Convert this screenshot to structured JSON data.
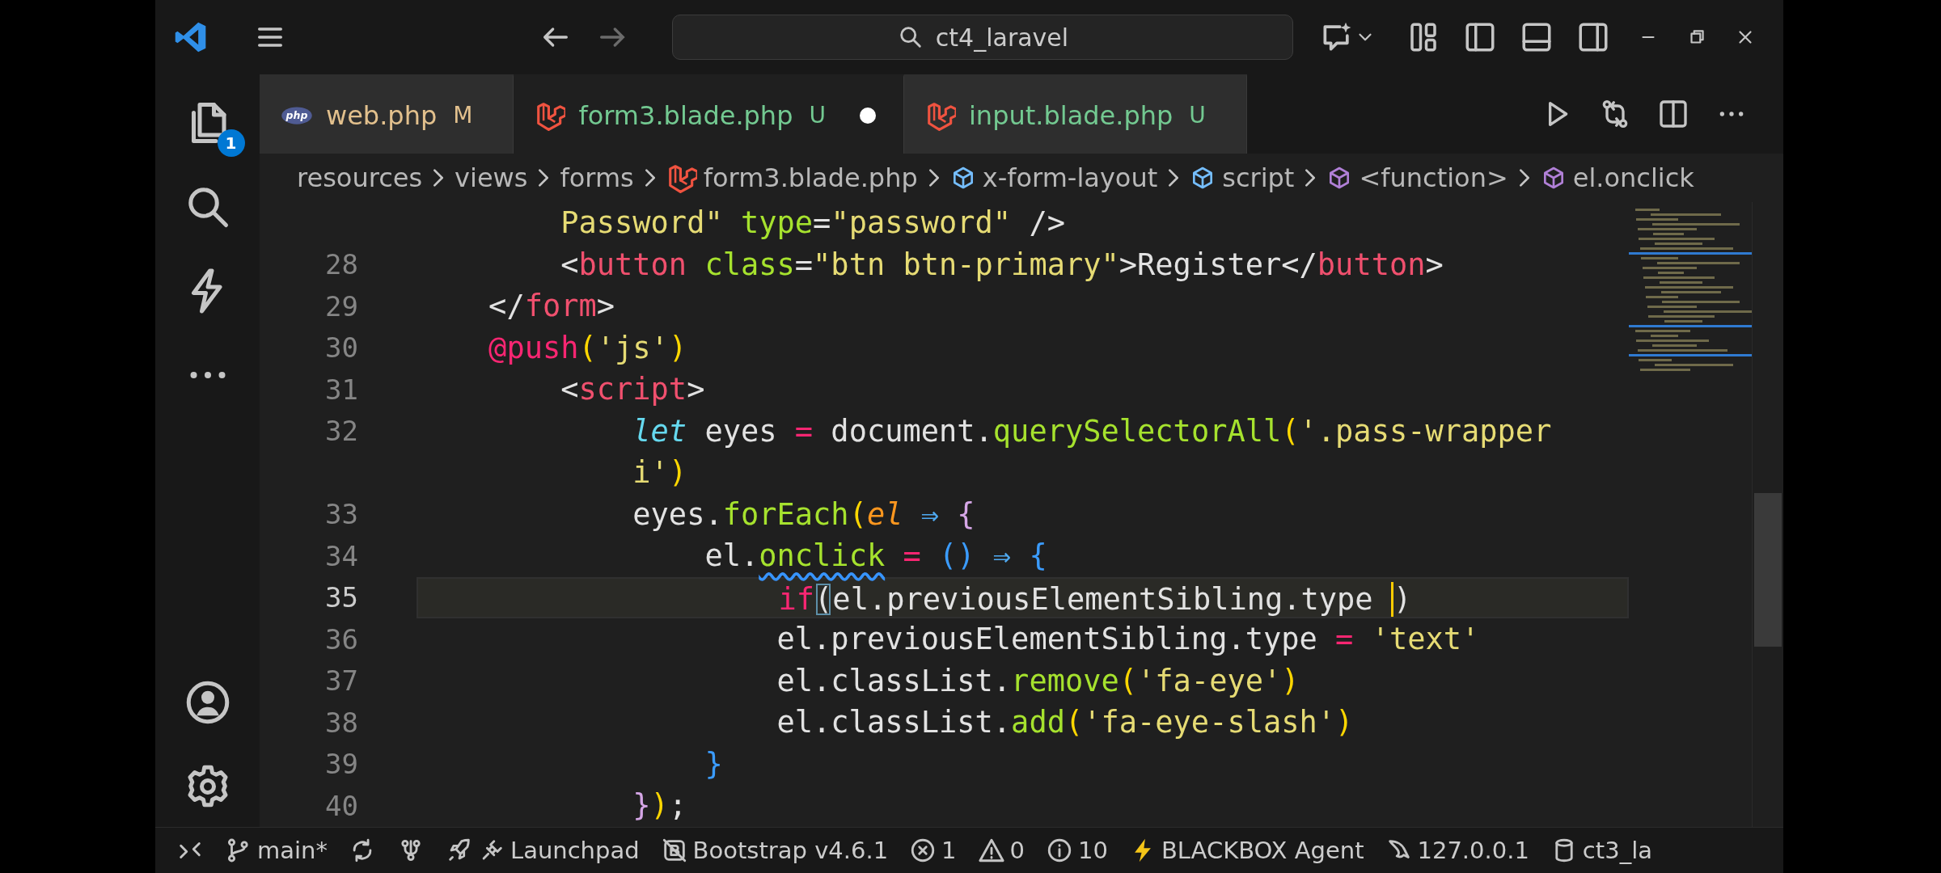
{
  "title_bar": {
    "search": "ct4_laravel"
  },
  "activity_bar": {
    "explorer_badge": "1"
  },
  "tabs": [
    {
      "label": "web.php",
      "kind": "php",
      "color": "#e2c08d",
      "status": "M",
      "selected": false,
      "dirty": false
    },
    {
      "label": "form3.blade.php",
      "kind": "blade",
      "color": "#73c991",
      "status": "U",
      "selected": true,
      "dirty": true
    },
    {
      "label": "input.blade.php",
      "kind": "blade",
      "color": "#73c991",
      "status": "U",
      "selected": false,
      "dirty": false
    }
  ],
  "breadcrumbs": [
    {
      "label": "resources",
      "kind": "folder"
    },
    {
      "label": "views",
      "kind": "folder"
    },
    {
      "label": "forms",
      "kind": "folder"
    },
    {
      "label": "form3.blade.php",
      "kind": "blade"
    },
    {
      "label": "x-form-layout",
      "kind": "element"
    },
    {
      "label": "script",
      "kind": "element"
    },
    {
      "label": "<function>",
      "kind": "method"
    },
    {
      "label": "el.onclick",
      "kind": "method"
    }
  ],
  "editor": {
    "lines": [
      {
        "current": false,
        "tokens": [
          {
            "text": "        Password\"",
            "kind": "string"
          },
          {
            "text": " type",
            "kind": "attr"
          },
          {
            "text": "=",
            "kind": "plain"
          },
          {
            "text": "\"password\"",
            "kind": "string"
          },
          {
            "text": " />",
            "kind": "plain"
          }
        ]
      },
      {
        "number": "28",
        "current": false,
        "tokens": [
          {
            "text": "        <",
            "kind": "plain"
          },
          {
            "text": "button",
            "kind": "tag"
          },
          {
            "text": " class",
            "kind": "attr"
          },
          {
            "text": "=",
            "kind": "plain"
          },
          {
            "text": "\"btn btn-primary\"",
            "kind": "string"
          },
          {
            "text": ">Register</",
            "kind": "plain"
          },
          {
            "text": "button",
            "kind": "tag"
          },
          {
            "text": ">",
            "kind": "plain"
          }
        ]
      },
      {
        "number": "29",
        "current": false,
        "tokens": [
          {
            "text": "    </",
            "kind": "plain"
          },
          {
            "text": "form",
            "kind": "tag"
          },
          {
            "text": ">",
            "kind": "plain"
          }
        ]
      },
      {
        "number": "30",
        "current": false,
        "tokens": [
          {
            "text": "    @push",
            "kind": "directive"
          },
          {
            "text": "(",
            "kind": "bracket1"
          },
          {
            "text": "'js'",
            "kind": "string"
          },
          {
            "text": ")",
            "kind": "bracket1"
          }
        ]
      },
      {
        "number": "31",
        "current": false,
        "tokens": [
          {
            "text": "        <",
            "kind": "plain"
          },
          {
            "text": "script",
            "kind": "tag"
          },
          {
            "text": ">",
            "kind": "plain"
          }
        ]
      },
      {
        "number": "32",
        "current": false,
        "tokens": [
          {
            "text": "            let",
            "kind": "keyword"
          },
          {
            "text": " eyes ",
            "kind": "plain"
          },
          {
            "text": "=",
            "kind": "op"
          },
          {
            "text": " document.",
            "kind": "plain"
          },
          {
            "text": "querySelectorAll",
            "kind": "func"
          },
          {
            "text": "(",
            "kind": "bracket1"
          },
          {
            "text": "'.pass-wrapper",
            "kind": "string"
          }
        ]
      },
      {
        "current": false,
        "tokens": [
          {
            "text": "            i'",
            "kind": "string"
          },
          {
            "text": ")",
            "kind": "bracket1"
          }
        ]
      },
      {
        "number": "33",
        "current": false,
        "tokens": [
          {
            "text": "            eyes.",
            "kind": "plain"
          },
          {
            "text": "forEach",
            "kind": "func"
          },
          {
            "text": "(",
            "kind": "bracket1"
          },
          {
            "text": "el",
            "kind": "param"
          },
          {
            "text": " ⇒ ",
            "kind": "arrow"
          },
          {
            "text": "{",
            "kind": "bracket2"
          }
        ]
      },
      {
        "number": "34",
        "current": false,
        "tokens": [
          {
            "text": "                el.",
            "kind": "plain"
          },
          {
            "text": "onclick",
            "kind": "func-warn"
          },
          {
            "text": " = ",
            "kind": "op"
          },
          {
            "text": "()",
            "kind": "bracket3"
          },
          {
            "text": " ⇒ ",
            "kind": "arrow"
          },
          {
            "text": "{",
            "kind": "bracket3"
          }
        ]
      },
      {
        "number": "35",
        "current": true,
        "tokens": [
          {
            "text": "                    if",
            "kind": "control"
          },
          {
            "text": "(",
            "kind": "match"
          },
          {
            "text": "el.previousElementSibling.type ",
            "kind": "plain"
          },
          {
            "text": ")",
            "kind": "caret"
          }
        ]
      },
      {
        "number": "36",
        "current": false,
        "tokens": [
          {
            "text": "                    el.previousElementSibling.type ",
            "kind": "plain"
          },
          {
            "text": "= ",
            "kind": "op"
          },
          {
            "text": "'text'",
            "kind": "string"
          }
        ]
      },
      {
        "number": "37",
        "current": false,
        "tokens": [
          {
            "text": "                    el.classList.",
            "kind": "plain"
          },
          {
            "text": "remove",
            "kind": "func"
          },
          {
            "text": "(",
            "kind": "bracket1"
          },
          {
            "text": "'fa-eye'",
            "kind": "string"
          },
          {
            "text": ")",
            "kind": "bracket1"
          }
        ]
      },
      {
        "number": "38",
        "current": false,
        "tokens": [
          {
            "text": "                    el.classList.",
            "kind": "plain"
          },
          {
            "text": "add",
            "kind": "func"
          },
          {
            "text": "(",
            "kind": "bracket1"
          },
          {
            "text": "'fa-eye-slash'",
            "kind": "string"
          },
          {
            "text": ")",
            "kind": "bracket1"
          }
        ]
      },
      {
        "number": "39",
        "current": false,
        "tokens": [
          {
            "text": "                }",
            "kind": "bracket3"
          }
        ]
      },
      {
        "number": "40",
        "current": false,
        "tokens": [
          {
            "text": "            }",
            "kind": "bracket2"
          },
          {
            "text": ")",
            "kind": "bracket1"
          },
          {
            "text": ";",
            "kind": "plain"
          }
        ]
      }
    ]
  },
  "status_bar": {
    "items": [
      {
        "kind": "remote"
      },
      {
        "kind": "branch",
        "text": "main*"
      },
      {
        "kind": "sync"
      },
      {
        "kind": "graph"
      },
      {
        "kind": "launchpad",
        "text": "Launchpad"
      },
      {
        "kind": "bootstrap",
        "text": "Bootstrap v4.6.1"
      },
      {
        "kind": "errors",
        "text": "1"
      },
      {
        "kind": "warnings",
        "text": "0"
      },
      {
        "kind": "info",
        "text": "10"
      },
      {
        "kind": "agent",
        "text": "BLACKBOX Agent"
      },
      {
        "kind": "server",
        "text": "127.0.0.1"
      },
      {
        "kind": "database",
        "text": "ct3_la"
      }
    ]
  }
}
